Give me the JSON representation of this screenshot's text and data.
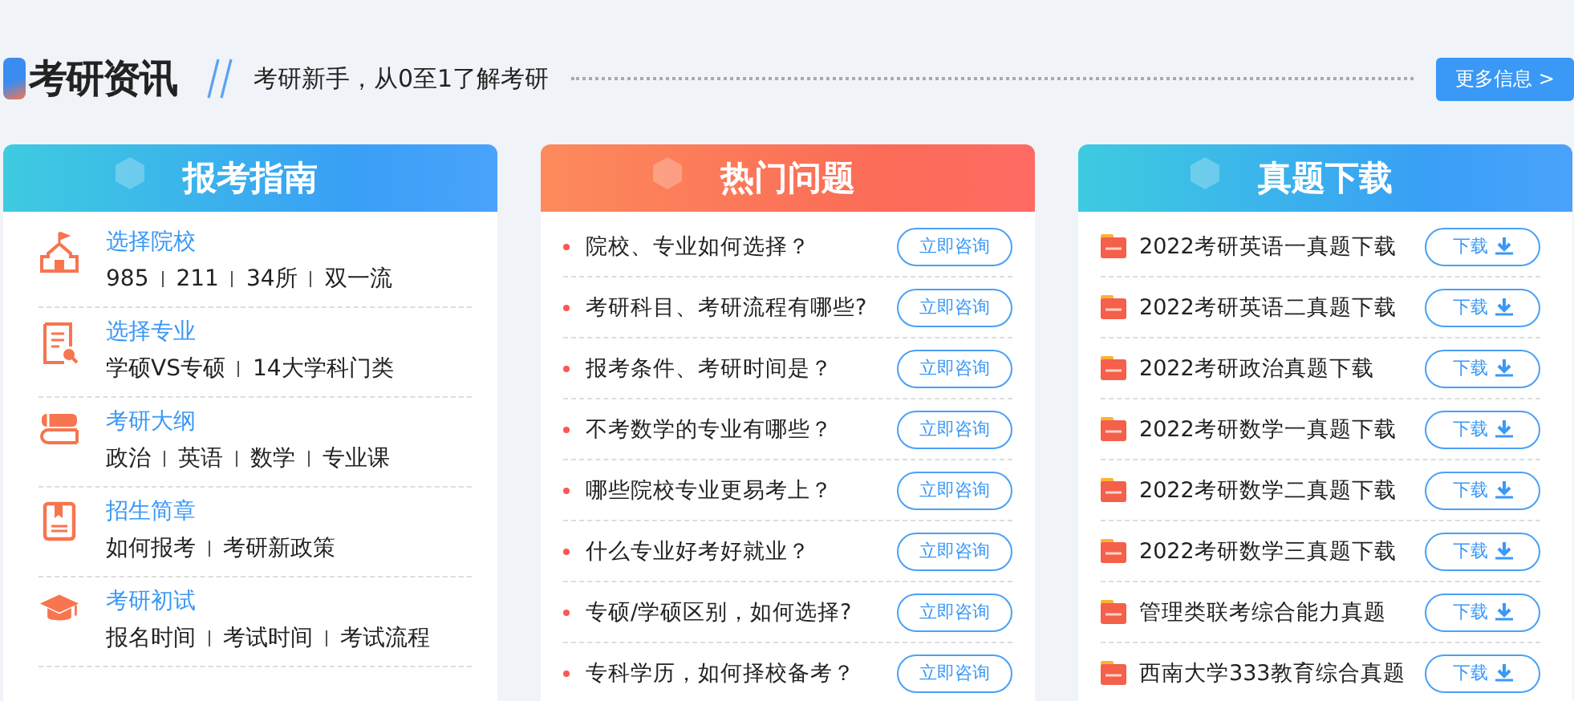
{
  "header": {
    "title": "考研资讯",
    "subtitle": "考研新手，从0至1了解考研",
    "more_button": "更多信息 >"
  },
  "panels": [
    {
      "kind": "guide",
      "title": "报考指南",
      "items": [
        {
          "title": "选择院校",
          "links": [
            "985",
            "211",
            "34所",
            "双一流"
          ]
        },
        {
          "title": "选择专业",
          "links": [
            "学硕VS专硕",
            "14大学科门类"
          ]
        },
        {
          "title": "考研大纲",
          "links": [
            "政治",
            "英语",
            "数学",
            "专业课"
          ]
        },
        {
          "title": "招生简章",
          "links": [
            "如何报考",
            "考研新政策"
          ]
        },
        {
          "title": "考研初试",
          "links": [
            "报名时间",
            "考试时间",
            "考试流程"
          ]
        }
      ]
    },
    {
      "kind": "questions",
      "title": "热门问题",
      "items": [
        {
          "text": "院校、专业如何选择？",
          "button": "立即咨询"
        },
        {
          "text": "考研科目、考研流程有哪些?",
          "button": "立即咨询"
        },
        {
          "text": "报考条件、考研时间是？",
          "button": "立即咨询"
        },
        {
          "text": "不考数学的专业有哪些？",
          "button": "立即咨询"
        },
        {
          "text": "哪些院校专业更易考上？",
          "button": "立即咨询"
        },
        {
          "text": "什么专业好考好就业？",
          "button": "立即咨询"
        },
        {
          "text": "专硕/学硕区别，如何选择?",
          "button": "立即咨询"
        },
        {
          "text": "专科学历，如何择校备考？",
          "button": "立即咨询"
        }
      ]
    },
    {
      "kind": "downloads",
      "title": "真题下载",
      "items": [
        {
          "text": "2022考研英语一真题下载",
          "button": "下载"
        },
        {
          "text": "2022考研英语二真题下载",
          "button": "下载"
        },
        {
          "text": "2022考研政治真题下载",
          "button": "下载"
        },
        {
          "text": "2022考研数学一真题下载",
          "button": "下载"
        },
        {
          "text": "2022考研数学二真题下载",
          "button": "下载"
        },
        {
          "text": "2022考研数学三真题下载",
          "button": "下载"
        },
        {
          "text": "管理类联考综合能力真题",
          "button": "下载"
        },
        {
          "text": "西南大学333教育综合真题",
          "button": "下载"
        }
      ]
    }
  ]
}
